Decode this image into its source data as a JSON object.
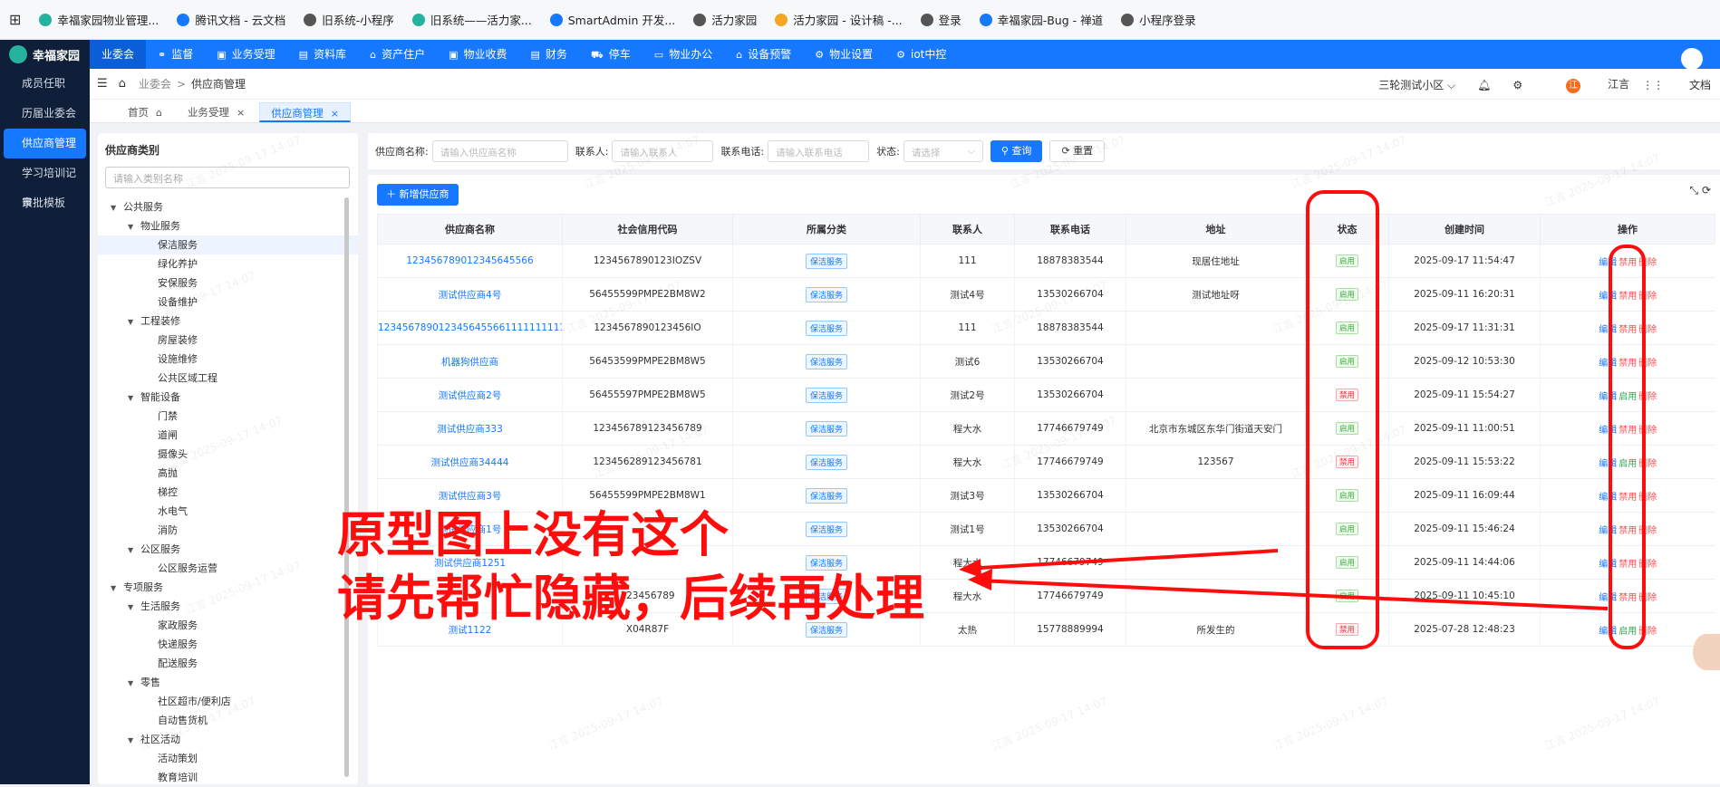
{
  "bookmarks": [
    {
      "label": "幸福家园物业管理...",
      "color": "#25b39e"
    },
    {
      "label": "腾讯文档 - 云文档",
      "color": "#1677ff"
    },
    {
      "label": "旧系统-小程序",
      "color": "#555555"
    },
    {
      "label": "旧系统——活力家...",
      "color": "#25b39e"
    },
    {
      "label": "SmartAdmin 开发...",
      "color": "#1677ff"
    },
    {
      "label": "活力家园",
      "color": "#555555"
    },
    {
      "label": "活力家园 - 设计稿 -...",
      "color": "#f5a623"
    },
    {
      "label": "登录",
      "color": "#555555"
    },
    {
      "label": "幸福家园-Bug - 禅道",
      "color": "#1677ff"
    },
    {
      "label": "小程序登录",
      "color": "#555555"
    }
  ],
  "app": {
    "brand": "幸福家园"
  },
  "sidebar": {
    "items": [
      {
        "label": "成员任职",
        "active": false
      },
      {
        "label": "历届业委会",
        "active": false
      },
      {
        "label": "供应商管理",
        "active": true
      },
      {
        "label": "学习培训记录",
        "active": false
      },
      {
        "label": "审批模板",
        "active": false
      }
    ]
  },
  "topnav": [
    {
      "label": "业委会",
      "icon": "",
      "active": true
    },
    {
      "label": "监督",
      "icon": "⚭",
      "active": false
    },
    {
      "label": "业务受理",
      "icon": "▣",
      "active": false
    },
    {
      "label": "资料库",
      "icon": "▤",
      "active": false
    },
    {
      "label": "资产住户",
      "icon": "⌂",
      "active": false
    },
    {
      "label": "物业收费",
      "icon": "▣",
      "active": false
    },
    {
      "label": "财务",
      "icon": "▤",
      "active": false
    },
    {
      "label": "停车",
      "icon": "⛟",
      "active": false
    },
    {
      "label": "物业办公",
      "icon": "▭",
      "active": false
    },
    {
      "label": "设备预警",
      "icon": "⌂",
      "active": false
    },
    {
      "label": "物业设置",
      "icon": "⚙",
      "active": false
    },
    {
      "label": "iot中控",
      "icon": "⚙",
      "active": false
    }
  ],
  "breadcrumb": {
    "home_icon": "⌂",
    "parent": "业委会",
    "sep": ">",
    "current": "供应商管理"
  },
  "header_right": {
    "community": "三轮测试小区",
    "user_initial": "江",
    "user": "江言",
    "doc": "文档"
  },
  "tabs": [
    {
      "label": "首页",
      "active": false
    },
    {
      "label": "业务受理",
      "active": false
    },
    {
      "label": "供应商管理",
      "active": true
    }
  ],
  "category": {
    "title": "供应商类别",
    "search_placeholder": "请输入类别名称",
    "tree": [
      {
        "label": "公共服务",
        "level": 0,
        "arrow": true
      },
      {
        "label": "物业服务",
        "level": 1,
        "arrow": true
      },
      {
        "label": "保洁服务",
        "level": 2,
        "selected": true
      },
      {
        "label": "绿化养护",
        "level": 2
      },
      {
        "label": "安保服务",
        "level": 2
      },
      {
        "label": "设备维护",
        "level": 2
      },
      {
        "label": "工程装修",
        "level": 1,
        "arrow": true
      },
      {
        "label": "房屋装修",
        "level": 2
      },
      {
        "label": "设施维修",
        "level": 2
      },
      {
        "label": "公共区域工程",
        "level": 2
      },
      {
        "label": "智能设备",
        "level": 1,
        "arrow": true
      },
      {
        "label": "门禁",
        "level": 2
      },
      {
        "label": "道闸",
        "level": 2
      },
      {
        "label": "摄像头",
        "level": 2
      },
      {
        "label": "高抛",
        "level": 2
      },
      {
        "label": "梯控",
        "level": 2
      },
      {
        "label": "水电气",
        "level": 2
      },
      {
        "label": "消防",
        "level": 2
      },
      {
        "label": "公区服务",
        "level": 1,
        "arrow": true
      },
      {
        "label": "公区服务运营",
        "level": 2
      },
      {
        "label": "专项服务",
        "level": 0,
        "arrow": true
      },
      {
        "label": "生活服务",
        "level": 1,
        "arrow": true
      },
      {
        "label": "家政服务",
        "level": 2
      },
      {
        "label": "快递服务",
        "level": 2
      },
      {
        "label": "配送服务",
        "level": 2
      },
      {
        "label": "零售",
        "level": 1,
        "arrow": true
      },
      {
        "label": "社区超市/便利店",
        "level": 2
      },
      {
        "label": "自动售货机",
        "level": 2
      },
      {
        "label": "社区活动",
        "level": 1,
        "arrow": true
      },
      {
        "label": "活动策划",
        "level": 2
      },
      {
        "label": "教育培训",
        "level": 2
      }
    ]
  },
  "filters": {
    "name_label": "供应商名称:",
    "name_placeholder": "请输入供应商名称",
    "contact_label": "联系人:",
    "contact_placeholder": "请输入联系人",
    "phone_label": "联系电话:",
    "phone_placeholder": "请输入联系电话",
    "status_label": "状态:",
    "status_placeholder": "请选择",
    "search_btn": "查询",
    "reset_btn": "重置"
  },
  "add_button": "新增供应商",
  "table": {
    "columns": [
      "供应商名称",
      "社会信用代码",
      "所属分类",
      "联系人",
      "联系电话",
      "地址",
      "状态",
      "创建时间",
      "操作"
    ],
    "rows": [
      {
        "name": "1234567890123456455​66",
        "code": "1234567890123IOZSV",
        "cat": "保洁服务",
        "contact": "111",
        "phone": "18878383544",
        "addr": "现居住地址",
        "status": "启用",
        "on": true,
        "time": "2025-09-17 11:54:47"
      },
      {
        "name": "测试供应商4号",
        "code": "56455599PMPE2BM8W2",
        "cat": "保洁服务",
        "contact": "测试4号",
        "phone": "13530266704",
        "addr": "测试地址呀",
        "status": "启用",
        "on": true,
        "time": "2025-09-11 16:20:31"
      },
      {
        "name": "123456789012345645566111111111111",
        "code": "1234567890123456IO",
        "cat": "保洁服务",
        "contact": "111",
        "phone": "18878383544",
        "addr": "",
        "status": "启用",
        "on": true,
        "time": "2025-09-17 11:31:31"
      },
      {
        "name": "机器狗供应商",
        "code": "56453599PMPE2BM8W5",
        "cat": "保洁服务",
        "contact": "测试6",
        "phone": "13530266704",
        "addr": "",
        "status": "启用",
        "on": true,
        "time": "2025-09-12 10:53:30"
      },
      {
        "name": "测试供应商2号",
        "code": "56455597PMPE2BM8W5",
        "cat": "保洁服务",
        "contact": "测试2号",
        "phone": "13530266704",
        "addr": "",
        "status": "禁用",
        "on": false,
        "time": "2025-09-11 15:54:27"
      },
      {
        "name": "测试供应商333",
        "code": "123456789123456789",
        "cat": "保洁服务",
        "contact": "程大水",
        "phone": "17746679749",
        "addr": "北京市东城区东华门街道天安门",
        "status": "启用",
        "on": true,
        "time": "2025-09-11 11:00:51"
      },
      {
        "name": "测试供应商34444",
        "code": "123456289123456781",
        "cat": "保洁服务",
        "contact": "程大水",
        "phone": "17746679749",
        "addr": "123567",
        "status": "禁用",
        "on": false,
        "time": "2025-09-11 15:53:22"
      },
      {
        "name": "测试供应商3号",
        "code": "56455599PMPE2BM8W1",
        "cat": "保洁服务",
        "contact": "测试3号",
        "phone": "13530266704",
        "addr": "",
        "status": "启用",
        "on": true,
        "time": "2025-09-11 16:09:44"
      },
      {
        "name": "测试供应商1号",
        "code": "",
        "cat": "保洁服务",
        "contact": "测试1号",
        "phone": "13530266704",
        "addr": "",
        "status": "启用",
        "on": true,
        "time": "2025-09-11 15:46:24"
      },
      {
        "name": "测试供应商1251",
        "code": "",
        "cat": "保洁服务",
        "contact": "程大水",
        "phone": "17746679749",
        "addr": "",
        "status": "启用",
        "on": true,
        "time": "2025-09-11 14:44:06"
      },
      {
        "name": "",
        "code": "123456789",
        "cat": "保洁服务",
        "contact": "程大水",
        "phone": "17746679749",
        "addr": "",
        "status": "启用",
        "on": true,
        "time": "2025-09-11 10:45:10"
      },
      {
        "name": "测试1122",
        "code": "X04R87F",
        "cat": "保洁服务",
        "contact": "太热",
        "phone": "15778889994",
        "addr": "所发生的",
        "status": "禁用",
        "on": false,
        "time": "2025-07-28 12:48:23"
      }
    ],
    "ops": {
      "edit": "编辑",
      "disable": "禁用",
      "enable": "启用",
      "delete": "删除"
    }
  },
  "watermark": "江言 2025-09-17 14:07",
  "annotation": {
    "line1": "原型图上没有这个",
    "line2": "请先帮忙隐藏，后续再处理",
    "color": "#ff0d0d"
  }
}
